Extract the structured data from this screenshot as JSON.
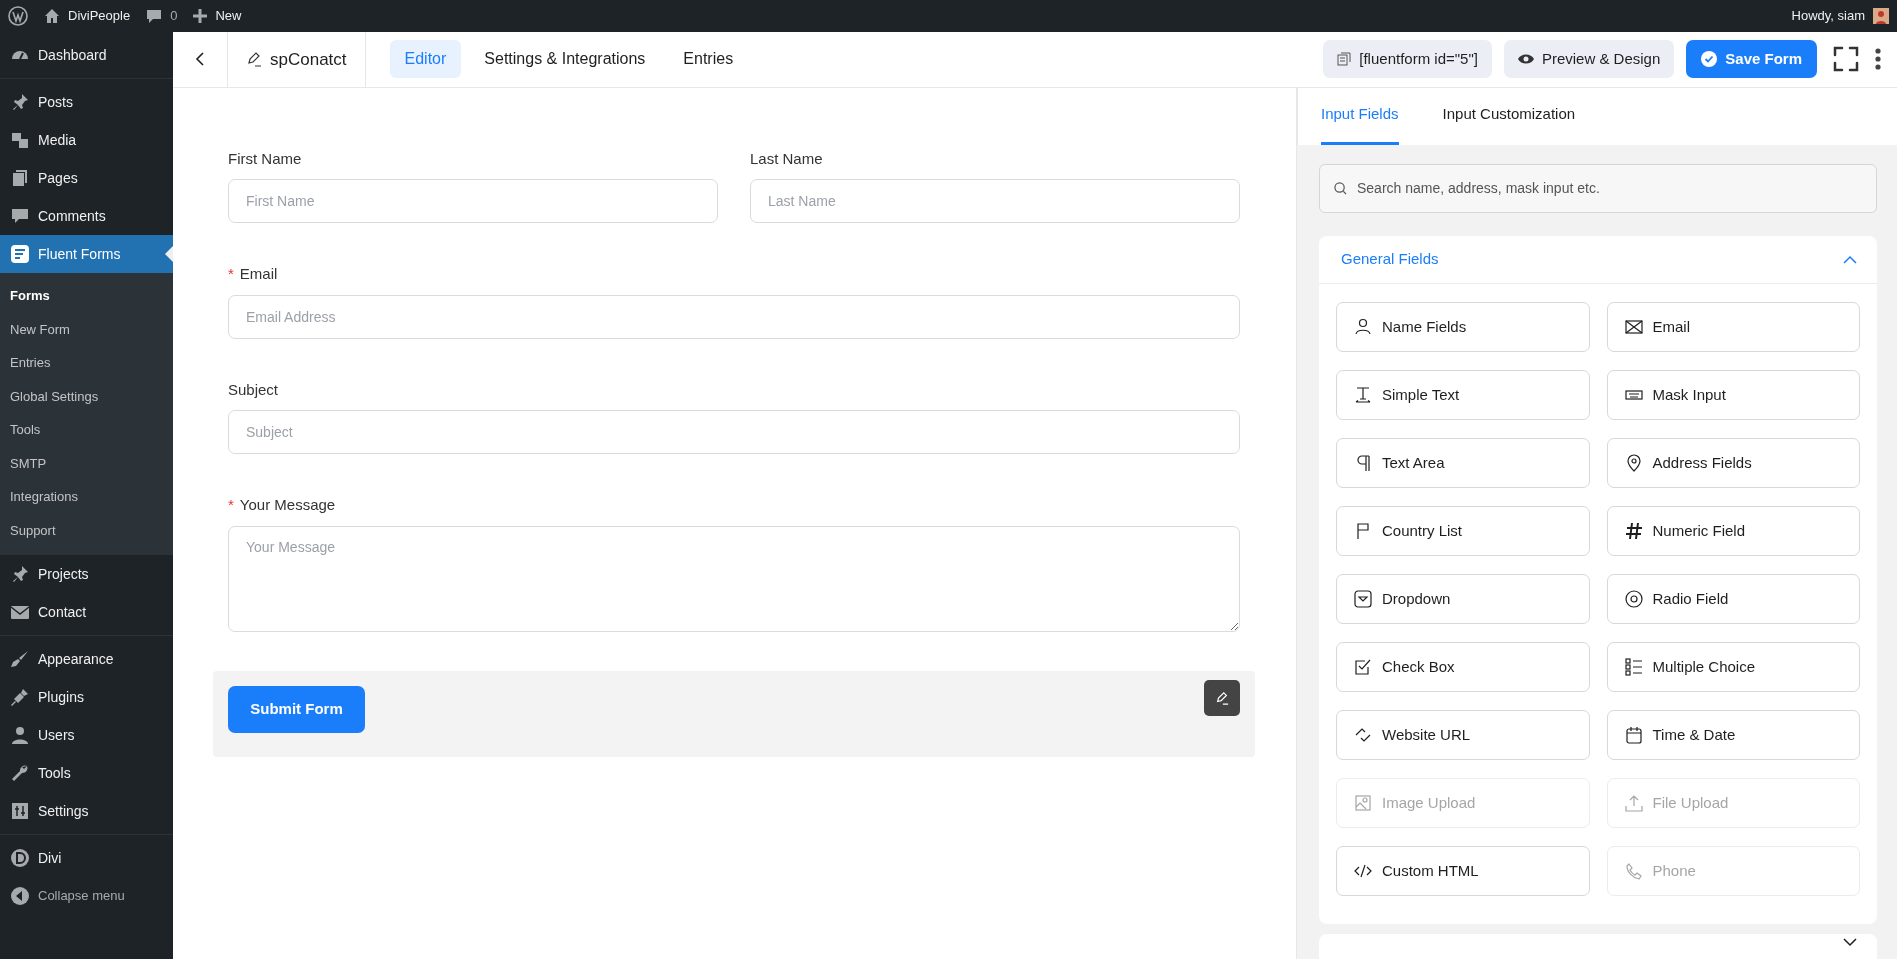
{
  "admin_bar": {
    "site": "DiviPeople",
    "comments": "0",
    "new": "New",
    "greeting": "Howdy, siam"
  },
  "sidebar": {
    "groups": [
      [
        {
          "label": "Dashboard",
          "selected": false
        }
      ],
      [
        {
          "label": "Posts",
          "selected": false
        },
        {
          "label": "Media",
          "selected": false
        },
        {
          "label": "Pages",
          "selected": false
        },
        {
          "label": "Comments",
          "selected": false
        },
        {
          "label": "Fluent Forms",
          "selected": true,
          "children": [
            {
              "label": "Forms",
              "selected": true
            },
            {
              "label": "New Form",
              "selected": false
            },
            {
              "label": "Entries",
              "selected": false
            },
            {
              "label": "Global Settings",
              "selected": false
            },
            {
              "label": "Tools",
              "selected": false
            },
            {
              "label": "SMTP",
              "selected": false
            },
            {
              "label": "Integrations",
              "selected": false
            },
            {
              "label": "Support",
              "selected": false
            }
          ]
        },
        {
          "label": "Projects",
          "selected": false
        },
        {
          "label": "Contact",
          "selected": false
        }
      ],
      [
        {
          "label": "Appearance",
          "selected": false
        },
        {
          "label": "Plugins",
          "selected": false
        },
        {
          "label": "Users",
          "selected": false
        },
        {
          "label": "Tools",
          "selected": false
        },
        {
          "label": "Settings",
          "selected": false
        }
      ],
      [
        {
          "label": "Divi",
          "selected": false
        },
        {
          "label": "Collapse menu",
          "selected": false
        }
      ]
    ]
  },
  "header": {
    "form_name": "spConatct",
    "tabs": [
      {
        "label": "Editor",
        "selected": true
      },
      {
        "label": "Settings & Integrations",
        "selected": false
      },
      {
        "label": "Entries",
        "selected": false
      }
    ],
    "shortcode": "[fluentform id=\"5\"]",
    "preview": "Preview & Design",
    "save": "Save Form"
  },
  "form": {
    "rows": [
      [
        {
          "label": "First Name",
          "placeholder": "First Name",
          "required": false,
          "kind": "text"
        },
        {
          "label": "Last Name",
          "placeholder": "Last Name",
          "required": false,
          "kind": "text"
        }
      ],
      [
        {
          "label": "Email",
          "placeholder": "Email Address",
          "required": true,
          "kind": "text"
        }
      ],
      [
        {
          "label": "Subject",
          "placeholder": "Subject",
          "required": false,
          "kind": "text"
        }
      ],
      [
        {
          "label": "Your Message",
          "placeholder": "Your Message",
          "required": true,
          "kind": "textarea"
        }
      ]
    ],
    "required_mark": "*",
    "submit": "Submit Form"
  },
  "panel": {
    "tabs": [
      {
        "label": "Input Fields",
        "selected": true
      },
      {
        "label": "Input Customization",
        "selected": false
      }
    ],
    "search": {
      "placeholder": "Search name, address, mask input etc."
    },
    "sections": [
      {
        "title": "General Fields",
        "expanded": true,
        "items": [
          {
            "label": "Name Fields",
            "disabled": false
          },
          {
            "label": "Email",
            "disabled": false
          },
          {
            "label": "Simple Text",
            "disabled": false
          },
          {
            "label": "Mask Input",
            "disabled": false
          },
          {
            "label": "Text Area",
            "disabled": false
          },
          {
            "label": "Address Fields",
            "disabled": false
          },
          {
            "label": "Country List",
            "disabled": false
          },
          {
            "label": "Numeric Field",
            "disabled": false
          },
          {
            "label": "Dropdown",
            "disabled": false
          },
          {
            "label": "Radio Field",
            "disabled": false
          },
          {
            "label": "Check Box",
            "disabled": false
          },
          {
            "label": "Multiple Choice",
            "disabled": false
          },
          {
            "label": "Website URL",
            "disabled": false
          },
          {
            "label": "Time & Date",
            "disabled": false
          },
          {
            "label": "Image Upload",
            "disabled": true
          },
          {
            "label": "File Upload",
            "disabled": true
          },
          {
            "label": "Custom HTML",
            "disabled": false
          },
          {
            "label": "Phone",
            "disabled": true
          }
        ]
      },
      {
        "expanded": false
      }
    ]
  }
}
